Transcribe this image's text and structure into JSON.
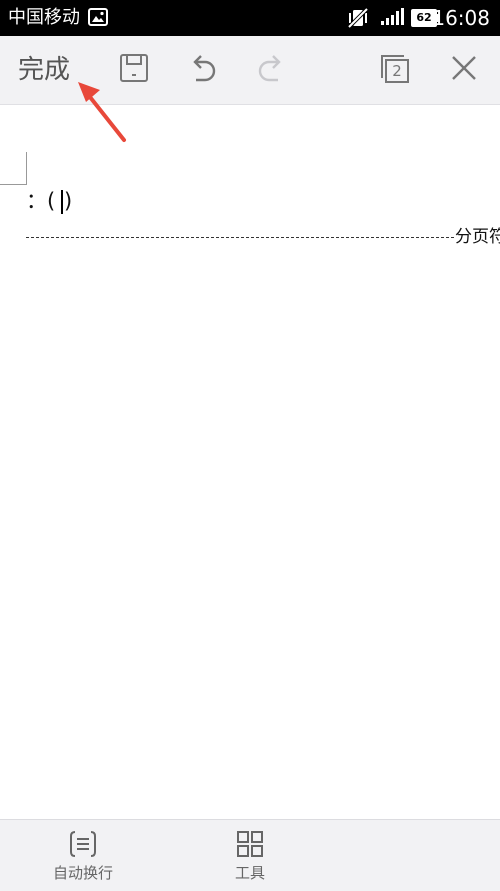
{
  "status_bar": {
    "carrier": "中国移动",
    "battery": "62",
    "time": "16:08"
  },
  "toolbar": {
    "done_label": "完成",
    "pages_count": "2"
  },
  "document": {
    "line_text_before_cursor": "：(",
    "line_text_after_cursor": ")",
    "page_break_label": "分页符"
  },
  "bottom_bar": {
    "wrap_label": "自动换行",
    "tools_label": "工具"
  },
  "colors": {
    "annotation_arrow": "#e8483a",
    "toolbar_bg": "#f2f2f4"
  },
  "icons": [
    "image-icon",
    "vibrate-off-icon",
    "signal-icon",
    "battery-icon",
    "save-icon",
    "undo-icon",
    "redo-icon",
    "pages-icon",
    "close-icon",
    "auto-wrap-icon",
    "tools-grid-icon",
    "annotation-arrow"
  ]
}
